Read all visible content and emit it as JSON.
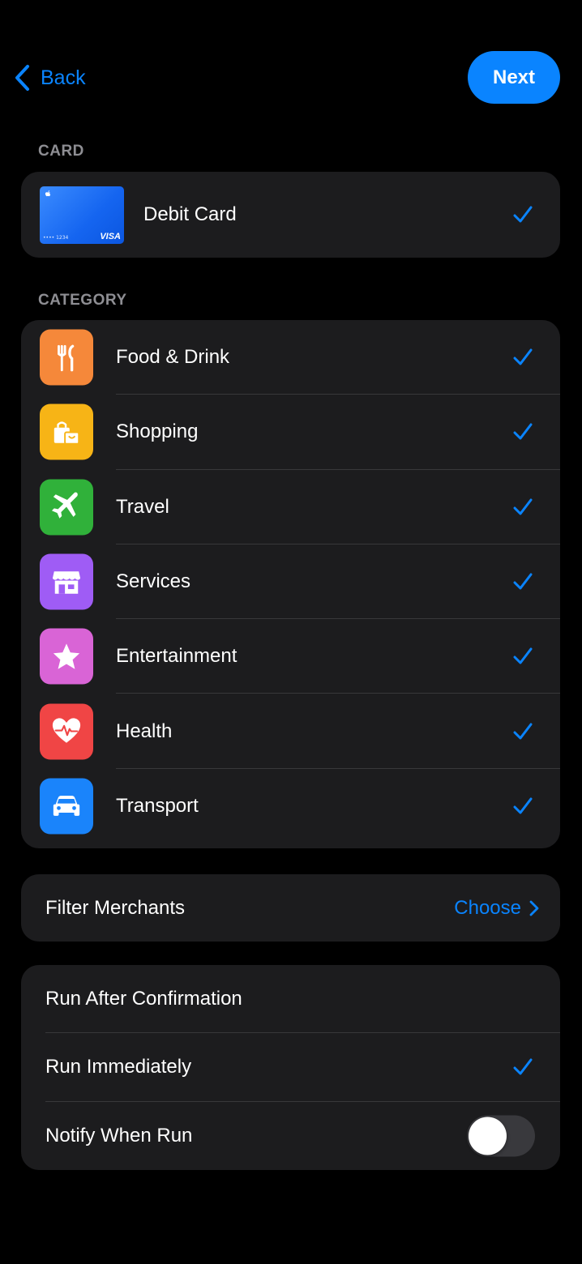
{
  "nav": {
    "back_label": "Back",
    "next_label": "Next"
  },
  "card_section": {
    "header": "CARD",
    "card": {
      "label": "Debit Card",
      "thumb_number": "•••• 1234",
      "thumb_brand": "VISA",
      "selected": true
    }
  },
  "category_section": {
    "header": "CATEGORY",
    "items": [
      {
        "label": "Food & Drink",
        "icon": "fork-knife-icon",
        "color": "#f5883a",
        "selected": true
      },
      {
        "label": "Shopping",
        "icon": "shopping-bag-icon",
        "color": "#f7b416",
        "selected": true
      },
      {
        "label": "Travel",
        "icon": "airplane-icon",
        "color": "#30b13a",
        "selected": true
      },
      {
        "label": "Services",
        "icon": "storefront-icon",
        "color": "#9f5cf5",
        "selected": true
      },
      {
        "label": "Entertainment",
        "icon": "star-icon",
        "color": "#d964d6",
        "selected": true
      },
      {
        "label": "Health",
        "icon": "heart-pulse-icon",
        "color": "#f04545",
        "selected": true
      },
      {
        "label": "Transport",
        "icon": "car-icon",
        "color": "#1a84fb",
        "selected": true
      }
    ]
  },
  "filter": {
    "label": "Filter Merchants",
    "action": "Choose"
  },
  "run_options": {
    "run_after_confirmation": {
      "label": "Run After Confirmation",
      "selected": false
    },
    "run_immediately": {
      "label": "Run Immediately",
      "selected": true
    },
    "notify_when_run": {
      "label": "Notify When Run",
      "enabled": false
    }
  },
  "colors": {
    "accent": "#0a84ff",
    "background": "#000000",
    "group_background": "#1c1c1e",
    "secondary_text": "#8e8e93"
  }
}
